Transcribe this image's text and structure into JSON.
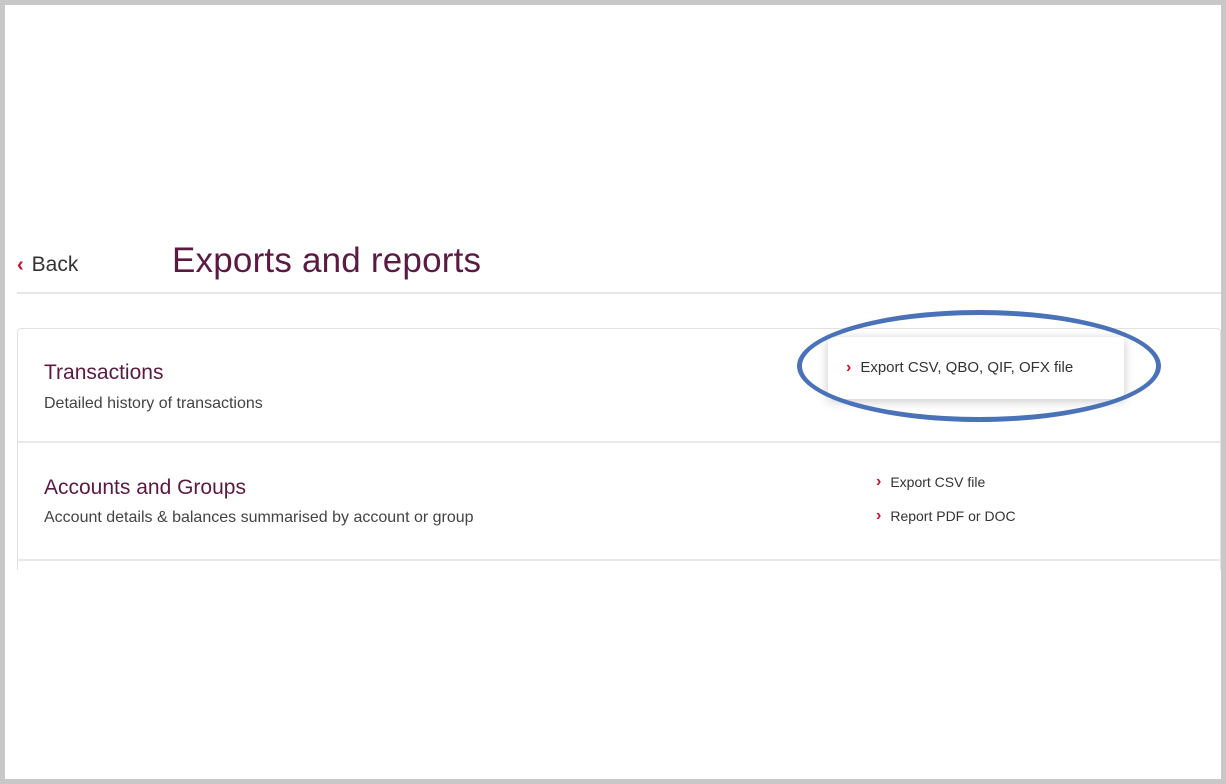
{
  "header": {
    "back_label": "Back",
    "title": "Exports and reports"
  },
  "sections": [
    {
      "title": "Transactions",
      "description": "Detailed history of transactions",
      "actions": [
        "Export CSV, QBO, QIF, OFX file"
      ]
    },
    {
      "title": "Accounts and Groups",
      "description": "Account details & balances summarised by account or group",
      "actions": [
        "Export CSV file",
        "Report PDF or DOC"
      ]
    }
  ],
  "icons": {
    "back": "chevron-left-icon",
    "action": "chevron-right-icon"
  },
  "colors": {
    "title": "#5b1a44",
    "accent": "#c8102e",
    "annotation": "#4a72b8"
  }
}
